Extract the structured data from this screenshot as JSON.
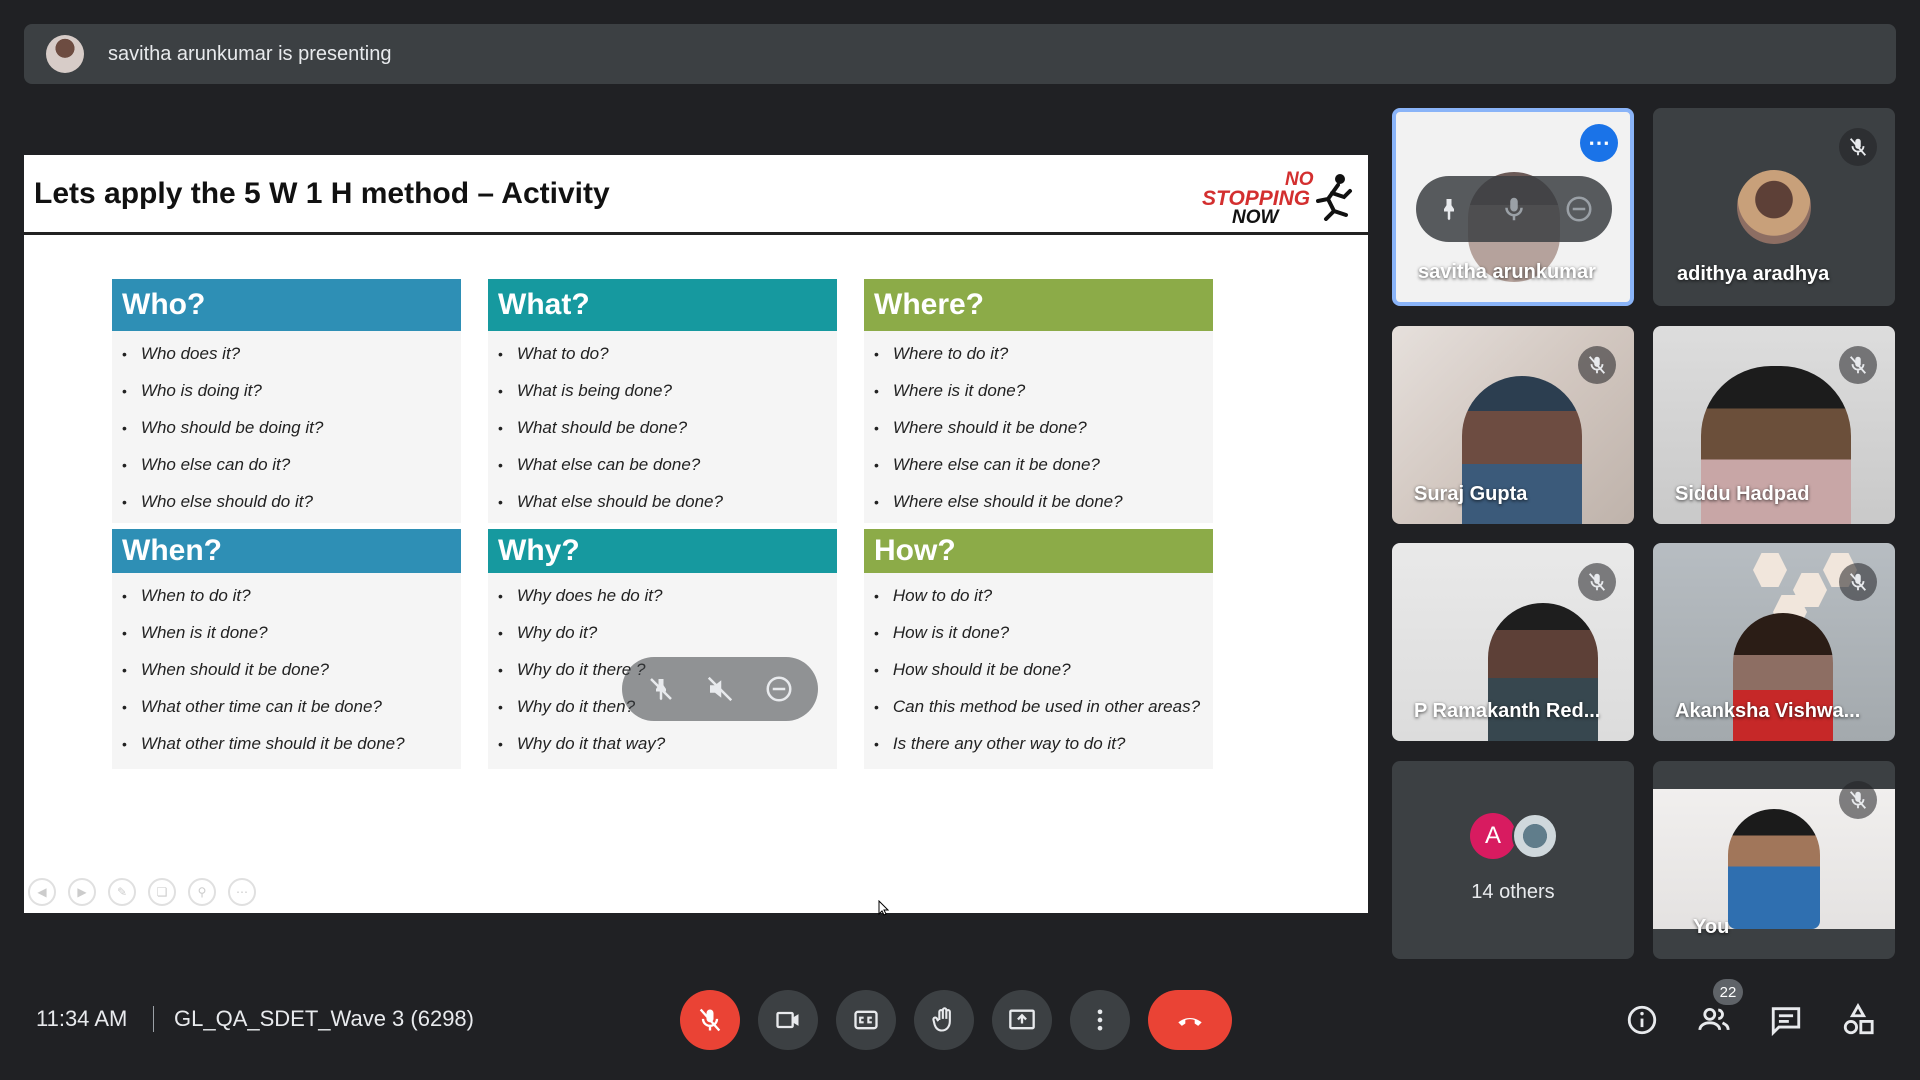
{
  "banner": {
    "presenter_text": "savitha arunkumar is presenting"
  },
  "slide": {
    "title": "Lets apply the 5 W 1 H method – Activity",
    "logo": {
      "line1": "NO",
      "line2": "STOPPING",
      "line3": "NOW"
    },
    "cards": [
      {
        "heading": "Who?",
        "items": [
          "Who does it?",
          "Who is doing it?",
          "Who should be doing it?",
          "Who else can do it?",
          "Who else should do it?"
        ]
      },
      {
        "heading": "What?",
        "items": [
          "What to do?",
          "What is being done?",
          "What should be done?",
          "What else can be done?",
          "What else should be done?"
        ]
      },
      {
        "heading": "Where?",
        "items": [
          "Where to do it?",
          "Where is it done?",
          "Where should it be done?",
          "Where else can it be done?",
          "Where else should it be done?"
        ]
      },
      {
        "heading": "When?",
        "items": [
          "When to do it?",
          "When is it done?",
          "When should it be done?",
          "What other time can it be done?",
          "What other time should it be done?"
        ]
      },
      {
        "heading": "Why?",
        "items": [
          "Why does he do it?",
          "Why do it?",
          "Why do it there ?",
          "Why do it then?",
          "Why do it that way?"
        ]
      },
      {
        "heading": "How?",
        "items": [
          "How to do it?",
          "How is it done?",
          "How should it be done?",
          "Can this method be used in other areas?",
          "Is there any other way to do it?"
        ]
      }
    ]
  },
  "participants": {
    "savitha": "savitha arunkumar",
    "adithya": "adithya aradhya",
    "suraj": "Suraj Gupta",
    "siddu": "Siddu Hadpad",
    "ramakanth": "P Ramakanth Red...",
    "akanksha": "Akanksha Vishwa...",
    "others_avatar_letter": "A",
    "others_count": "14 others",
    "you": "You"
  },
  "bottom_bar": {
    "time": "11:34 AM",
    "meeting_name": "GL_QA_SDET_Wave 3 (6298)",
    "people_count": "22"
  },
  "colors": {
    "accent": "#1a73e8",
    "end_call": "#ea4335",
    "who_blue": "#2e8fb5",
    "what_teal": "#16999f",
    "where_green": "#8cab48"
  }
}
